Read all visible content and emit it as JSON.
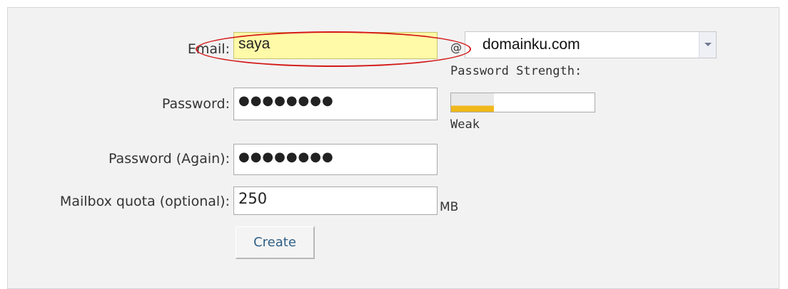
{
  "form": {
    "email_label": "Email:",
    "email_value": "saya",
    "at_sign": "@",
    "domain_value": "domainku.com",
    "password_strength_label": "Password Strength:",
    "password_label": "Password:",
    "password_value": "●●●●●●●●",
    "password_again_label": "Password (Again):",
    "password_again_value": "●●●●●●●●",
    "strength_text": "Weak",
    "strength_fraction": 0.3,
    "quota_label": "Mailbox quota (optional):",
    "quota_value": "250",
    "quota_unit": "MB",
    "create_label": "Create"
  },
  "colors": {
    "highlight_field": "#fffaa8",
    "annotation_ellipse": "#d41818",
    "strength_weak": "#f0b81a"
  }
}
